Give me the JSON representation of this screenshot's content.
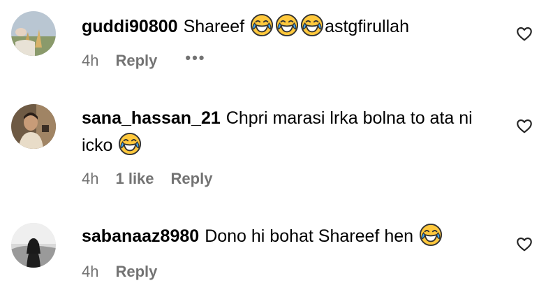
{
  "comments": [
    {
      "username": "guddi90800",
      "text_before": "Shareef",
      "text_after": "astgfirullah",
      "emoji_count": 3,
      "time": "4h",
      "likes": "",
      "reply_label": "Reply",
      "more_label": "•••"
    },
    {
      "username": "sana_hassan_21",
      "text_before": "Chpri marasi lrka bolna to ata ni icko",
      "time": "4h",
      "likes": "1 like",
      "reply_label": "Reply"
    },
    {
      "username": "sabanaaz8980",
      "text_before": "Dono hi bohat Shareef hen",
      "time": "4h",
      "reply_label": "Reply"
    }
  ],
  "colors": {
    "meta_gray": "#737373",
    "text": "#000000",
    "emoji_face": "#FFC83D",
    "emoji_tear": "#3FA9F5"
  },
  "icons": [
    "heart-outline-icon",
    "tears-of-joy-emoji",
    "more-dots-icon"
  ]
}
